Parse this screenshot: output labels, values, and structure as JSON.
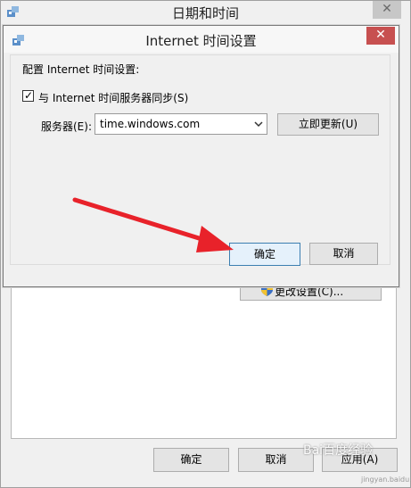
{
  "outer_window": {
    "title": "日期和时间",
    "change_settings_label": "更改设置(C)...",
    "buttons": {
      "ok": "确定",
      "cancel": "取消",
      "apply": "应用(A)"
    }
  },
  "dialog": {
    "title": "Internet 时间设置",
    "config_label": "配置 Internet 时间设置:",
    "sync_label": "与 Internet 时间服务器同步(S)",
    "sync_checked": true,
    "server_label": "服务器(E):",
    "server_value": "time.windows.com",
    "update_button": "立即更新(U)",
    "ok_button": "确定",
    "cancel_button": "取消"
  },
  "watermark": {
    "text": "Bai百度经验",
    "sub": "jingyan.baidu.com"
  },
  "colors": {
    "dialog_close_bg": "#c75050",
    "ok_button_border": "#3c7fb1",
    "annotation_arrow": "#e8222a"
  }
}
